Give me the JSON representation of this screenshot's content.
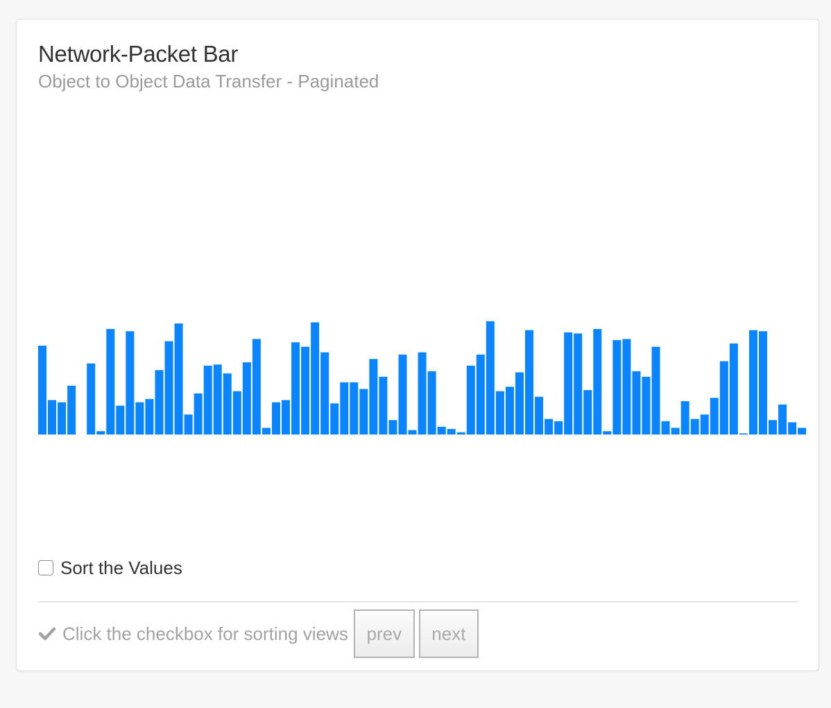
{
  "card": {
    "title": "Network-Packet Bar",
    "subtitle": "Object to Object Data Transfer - Paginated"
  },
  "controls": {
    "sort_label": "Sort the Values",
    "sort_checked": false,
    "hint_icon": "check-icon",
    "hint_text": "Click the checkbox for sorting views",
    "prev_label": "prev",
    "next_label": "next"
  },
  "colors": {
    "bar": "#0a84ff",
    "muted_text": "#a2a2a2"
  },
  "chart_data": {
    "type": "bar",
    "title": "Network-Packet Bar",
    "subtitle": "Object to Object Data Transfer - Paginated",
    "xlabel": "",
    "ylabel": "",
    "axes_visible": false,
    "grid": false,
    "legend": "none",
    "ylim": [
      0,
      100
    ],
    "values": [
      80,
      31,
      29,
      44,
      0,
      64,
      3,
      95,
      26,
      93,
      29,
      32,
      58,
      84,
      100,
      18,
      37,
      62,
      63,
      55,
      39,
      65,
      86,
      6,
      29,
      31,
      83,
      79,
      101,
      74,
      28,
      47,
      47,
      41,
      68,
      52,
      13,
      72,
      4,
      74,
      57,
      7,
      5,
      2,
      62,
      72,
      102,
      39,
      43,
      56,
      94,
      34,
      14,
      12,
      92,
      91,
      40,
      95,
      3,
      85,
      86,
      57,
      52,
      79,
      12,
      6,
      30,
      14,
      18,
      33,
      66,
      82,
      1,
      94,
      93,
      13,
      27,
      11,
      6
    ]
  }
}
